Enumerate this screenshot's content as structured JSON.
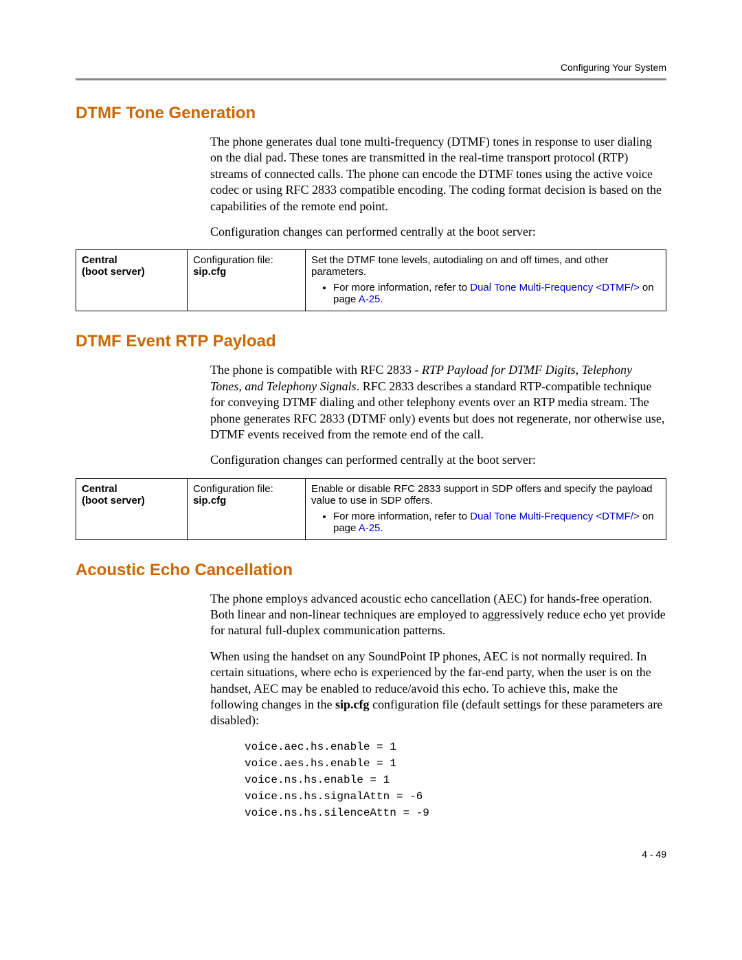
{
  "header": {
    "running": "Configuring Your System"
  },
  "sections": {
    "dtmf_gen": {
      "title": "DTMF Tone Generation",
      "p1": "The phone generates dual tone multi-frequency (DTMF) tones in response to user dialing on the dial pad. These tones are transmitted in the real-time transport protocol (RTP) streams of connected calls. The phone can encode the DTMF tones using the active voice codec or using RFC 2833 compatible encoding. The coding format decision is based on the capabilities of the remote end point.",
      "p2": "Configuration changes can performed centrally at the boot server:",
      "table": {
        "col1_l1": "Central",
        "col1_l2": "(boot server)",
        "col2_l1": "Configuration file:",
        "col2_l2": "sip.cfg",
        "col3_p": "Set the DTMF tone levels, autodialing on and off times, and other parameters.",
        "bullet_pre": "For more information, refer to ",
        "bullet_link": "Dual Tone Multi-Frequency <DTMF/>",
        "bullet_mid": " on page ",
        "bullet_page": "A-25",
        "bullet_post": "."
      }
    },
    "dtmf_rtp": {
      "title": "DTMF Event RTP Payload",
      "p1_pre": "The phone is compatible with RFC 2833 - ",
      "p1_em": "RTP Payload for DTMF Digits, Telephony Tones, and Telephony Signals",
      "p1_post": ". RFC 2833 describes a standard RTP-compatible technique for conveying DTMF dialing and other telephony events over an RTP media stream. The phone generates RFC 2833 (DTMF only) events but does not regenerate, nor otherwise use, DTMF events received from the remote end of the call.",
      "p2": "Configuration changes can performed centrally at the boot server:",
      "table": {
        "col1_l1": "Central",
        "col1_l2": "(boot server)",
        "col2_l1": "Configuration file:",
        "col2_l2": "sip.cfg",
        "col3_p": "Enable or disable RFC 2833 support in SDP offers and specify the payload value to use in SDP offers.",
        "bullet_pre": "For more information, refer to ",
        "bullet_link": "Dual Tone Multi-Frequency <DTMF/>",
        "bullet_mid": " on page ",
        "bullet_page": "A-25",
        "bullet_post": "."
      }
    },
    "aec": {
      "title": "Acoustic Echo Cancellation",
      "p1": "The phone employs advanced acoustic echo cancellation (AEC) for hands-free operation. Both linear and non-linear techniques are employed to aggressively reduce echo yet provide for natural full-duplex communication patterns.",
      "p2_pre": "When using the handset on any SoundPoint IP phones, AEC is not normally required. In certain situations, where echo is experienced by the far-end party, when the user is on the handset, AEC may be enabled to reduce/avoid this echo. To achieve this, make the following changes in the ",
      "p2_bold": "sip.cfg",
      "p2_post": " configuration file (default settings for these parameters are disabled):",
      "code": "voice.aec.hs.enable = 1\nvoice.aes.hs.enable = 1\nvoice.ns.hs.enable = 1\nvoice.ns.hs.signalAttn = -6\nvoice.ns.hs.silenceAttn = -9"
    }
  },
  "footer": {
    "pagenum": "4 - 49"
  }
}
